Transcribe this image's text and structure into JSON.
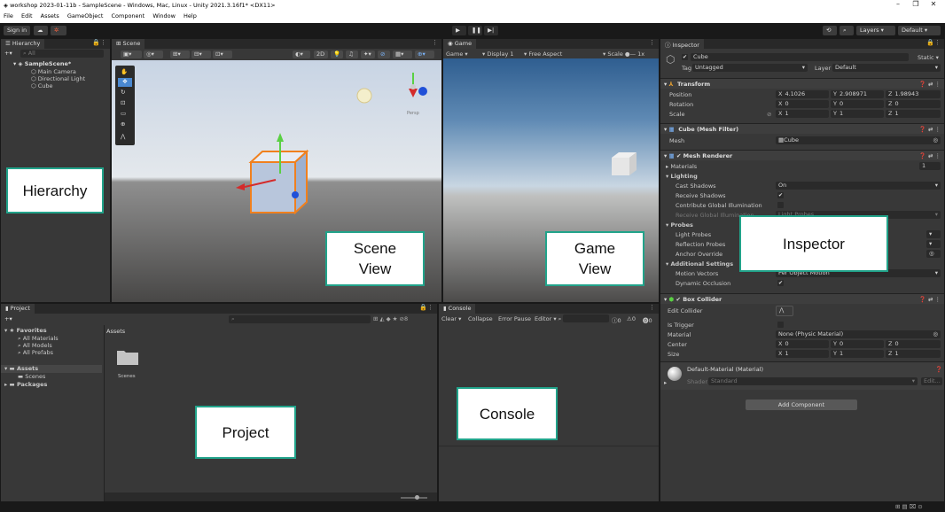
{
  "window": {
    "title": "workshop 2023-01-11b - SampleScene - Windows, Mac, Linux - Unity 2021.3.16f1* <DX11>",
    "minimize_icon": "–",
    "maximize_icon": "❐",
    "close_icon": "✕"
  },
  "menu": [
    "File",
    "Edit",
    "Assets",
    "GameObject",
    "Component",
    "Window",
    "Help"
  ],
  "toolbar": {
    "sign_in": "Sign in",
    "layers": "Layers",
    "layout": "Default"
  },
  "hierarchy": {
    "tab": "Hierarchy",
    "search_placeholder": "All",
    "scene": "SampleScene*",
    "items": [
      "Main Camera",
      "Directional Light",
      "Cube"
    ]
  },
  "scene_view": {
    "tab": "Scene",
    "mode_2d": "2D",
    "persp_label": "Persp"
  },
  "game_view": {
    "tab": "Game",
    "mode": "Game",
    "display": "Display 1",
    "aspect": "Free Aspect",
    "scale_label": "Scale",
    "scale_value": "1x"
  },
  "inspector": {
    "tab": "Inspector",
    "object_name": "Cube",
    "static_label": "Static",
    "tag_label": "Tag",
    "tag_value": "Untagged",
    "layer_label": "Layer",
    "layer_value": "Default",
    "transform": {
      "title": "Transform",
      "position_label": "Position",
      "rotation_label": "Rotation",
      "scale_label": "Scale",
      "position": {
        "x": "4.1026",
        "y": "2.908971",
        "z": "1.98943"
      },
      "rotation": {
        "x": "0",
        "y": "0",
        "z": "0"
      },
      "scale": {
        "x": "1",
        "y": "1",
        "z": "1"
      }
    },
    "mesh_filter": {
      "title": "Cube (Mesh Filter)",
      "mesh_label": "Mesh",
      "mesh_value": "Cube"
    },
    "mesh_renderer": {
      "title": "Mesh Renderer",
      "materials_label": "Materials",
      "materials_count": "1",
      "lighting_label": "Lighting",
      "cast_shadows_label": "Cast Shadows",
      "cast_shadows_value": "On",
      "receive_shadows_label": "Receive Shadows",
      "contribute_gi_label": "Contribute Global Illumination",
      "receive_gi_label": "Receive Global Illumination",
      "receive_gi_value": "Light Probes",
      "probes_label": "Probes",
      "light_probes_label": "Light Probes",
      "reflection_probes_label": "Reflection Probes",
      "anchor_override_label": "Anchor Override",
      "additional_settings_label": "Additional Settings",
      "motion_vectors_label": "Motion Vectors",
      "motion_vectors_value": "Per Object Motion",
      "dynamic_occlusion_label": "Dynamic Occlusion"
    },
    "box_collider": {
      "title": "Box Collider",
      "edit_collider_label": "Edit Collider",
      "is_trigger_label": "Is Trigger",
      "material_label": "Material",
      "material_value": "None (Physic Material)",
      "center_label": "Center",
      "size_label": "Size",
      "center": {
        "x": "0",
        "y": "0",
        "z": "0"
      },
      "size": {
        "x": "1",
        "y": "1",
        "z": "1"
      }
    },
    "material": {
      "name": "Default-Material (Material)",
      "shader_label": "Shader",
      "shader_value": "Standard",
      "edit_label": "Edit..."
    },
    "add_component": "Add Component"
  },
  "project": {
    "tab": "Project",
    "favorites_label": "Favorites",
    "favorites": [
      "All Materials",
      "All Models",
      "All Prefabs"
    ],
    "assets_label": "Assets",
    "assets_children": [
      "Scenes"
    ],
    "packages_label": "Packages",
    "breadcrumb": "Assets",
    "folder_name": "Scenes",
    "hidden_count": "8"
  },
  "console": {
    "tab": "Console",
    "clear": "Clear",
    "collapse": "Collapse",
    "error_pause": "Error Pause",
    "editor": "Editor",
    "log_count": "0",
    "warn_count": "0",
    "error_count": "0"
  },
  "callouts": {
    "hierarchy": "Hierarchy",
    "scene_view_1": "Scene",
    "scene_view_2": "View",
    "game_view_1": "Game",
    "game_view_2": "View",
    "inspector": "Inspector",
    "project": "Project",
    "console": "Console"
  },
  "colors": {
    "callout_border": "#21a38a",
    "selection_orange": "#f0801e",
    "play_blue": "#4a8ad4"
  }
}
